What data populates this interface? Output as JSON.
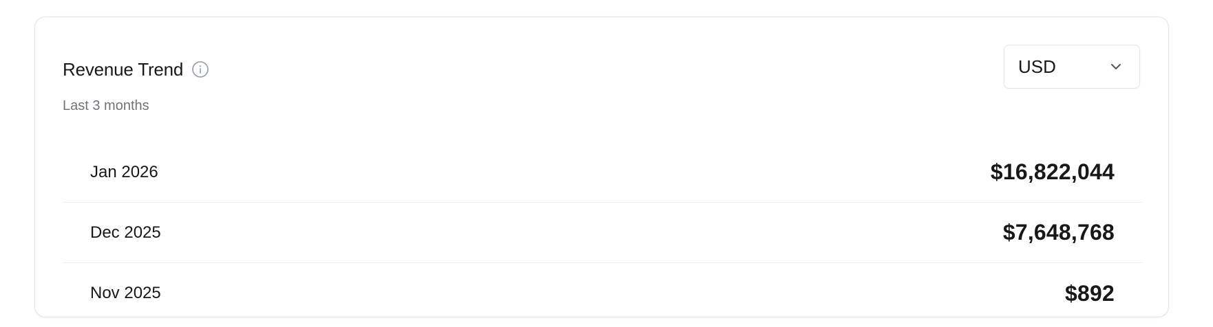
{
  "card": {
    "title": "Revenue Trend",
    "subtitle": "Last 3 months",
    "info_icon": "info-icon"
  },
  "currency_select": {
    "selected": "USD",
    "icon": "chevron-down-icon"
  },
  "revenue_rows": [
    {
      "label": "Jan 2026",
      "value": "$16,822,044"
    },
    {
      "label": "Dec 2025",
      "value": "$7,648,768"
    },
    {
      "label": "Nov 2025",
      "value": "$892"
    }
  ],
  "colors": {
    "text_primary": "#18181b",
    "text_muted": "#71717a",
    "border": "#e4e4e7"
  }
}
